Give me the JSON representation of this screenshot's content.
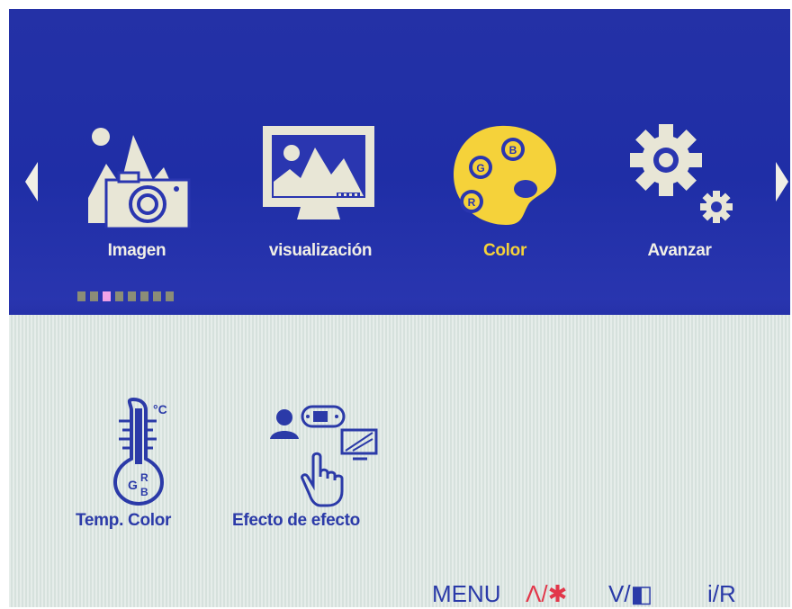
{
  "menu": {
    "tabs": [
      {
        "label": "Imagen",
        "icon": "image-camera-icon",
        "active": false
      },
      {
        "label": "visualización",
        "icon": "display-monitor-icon",
        "active": false
      },
      {
        "label": "Color",
        "icon": "palette-icon",
        "active": true
      },
      {
        "label": "Avanzar",
        "icon": "gears-icon",
        "active": false
      }
    ],
    "active_index": 2,
    "page_dots": 8,
    "active_dot": 2,
    "palette_letters": {
      "g": "G",
      "b": "B",
      "r": "R"
    }
  },
  "submenu": {
    "items": [
      {
        "label": "Temp. Color",
        "icon": "thermometer-icon",
        "unit": "°C",
        "letters": {
          "g": "G",
          "r": "R",
          "b": "B"
        }
      },
      {
        "label": "Efecto de efecto",
        "icon": "effect-scene-icon"
      }
    ]
  },
  "hints": {
    "menu": "MENU",
    "up": "Λ/✱",
    "down": "V/◧",
    "input": "i/R"
  },
  "colors": {
    "top_bg": "#1f2ea6",
    "bottom_bg": "#dde7e3",
    "tab_text": "#f1efe6",
    "active_text": "#f5d23a",
    "sub_text": "#2b3aa8",
    "hint_red": "#e2374a"
  }
}
